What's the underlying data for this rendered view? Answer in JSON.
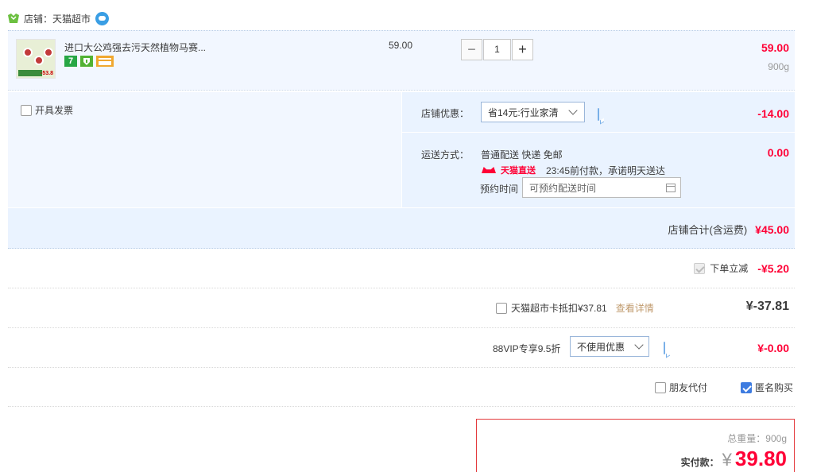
{
  "shop": {
    "label": "店铺：天猫超市"
  },
  "item": {
    "title": "进口大公鸡强去污天然植物马赛...",
    "thumb_price": "-53.8",
    "badge_1": "7",
    "badge_2": "",
    "unit_price": "59.00",
    "quantity": "1",
    "minus": "−",
    "plus": "+",
    "subtotal": "59.00",
    "weight": "900g"
  },
  "invoice": {
    "label": "开具发票"
  },
  "discount": {
    "label": "店铺优惠：",
    "selected": "省14元:行业家清",
    "amount": "-14.00"
  },
  "delivery": {
    "label": "运送方式：",
    "method": "普通配送 快递 免邮",
    "amount": "0.00",
    "tmall_logo": "天猫直送",
    "promise": "23:45前付款，承诺明天送达",
    "reserve_label": "预约时间",
    "reserve_placeholder": "可预约配送时间"
  },
  "shop_total": {
    "label": "店铺合计(含运费)",
    "amount": "¥45.00"
  },
  "instant_discount": {
    "label": "下单立减",
    "amount": "-¥5.20"
  },
  "tmall_card": {
    "label": "天猫超市卡抵扣¥37.81",
    "link": "查看详情",
    "amount": "¥-37.81"
  },
  "vip": {
    "label": "88VIP专享9.5折",
    "selected": "不使用优惠",
    "amount": "¥-0.00"
  },
  "options": {
    "friend_pay": "朋友代付",
    "anonymous": "匿名购买"
  },
  "summary": {
    "weight": "总重量：900g",
    "pay_label": "实付款：",
    "currency": "¥",
    "pay_amount": "39.80"
  },
  "colors": {
    "accent_red": "#ff0036",
    "panel_blue": "#eaf3ff",
    "check_blue": "#3d7be0"
  }
}
